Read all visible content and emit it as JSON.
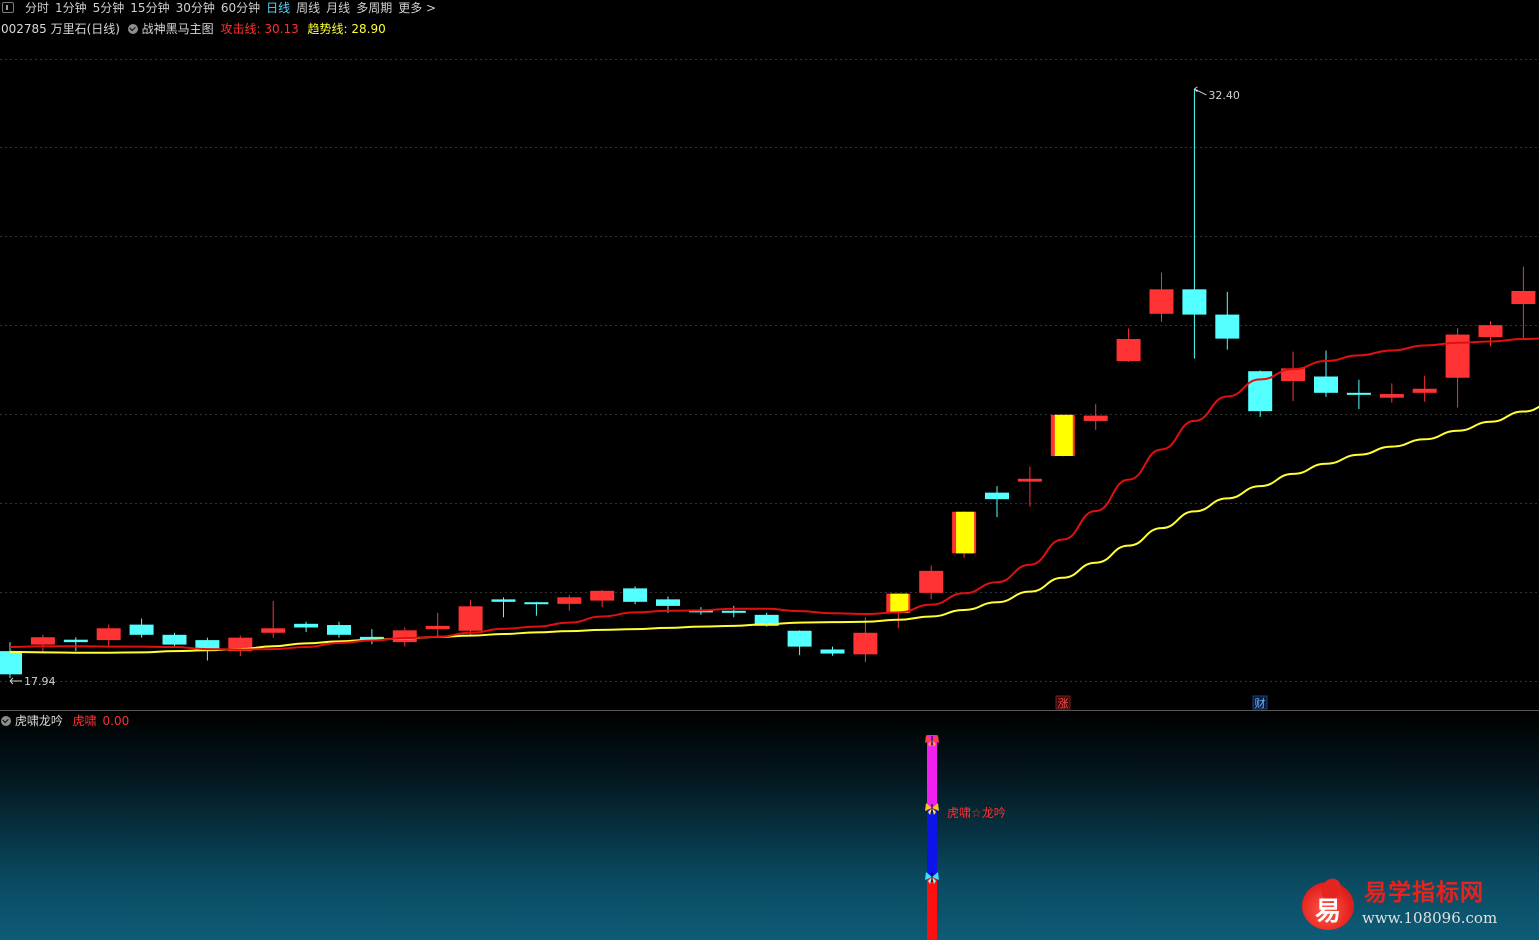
{
  "toolbar": {
    "periods": [
      "分时",
      "1分钟",
      "5分钟",
      "15分钟",
      "30分钟",
      "60分钟",
      "日线",
      "周线",
      "月线",
      "多周期",
      "更多"
    ],
    "active_period": "日线",
    "more_arrow": ">"
  },
  "header": {
    "stock": "002785 万里石(日线)",
    "indicator_name": "战神黑马主图",
    "attack_label": "攻击线: 30.13",
    "trend_label": "趋势线: 28.90"
  },
  "colors": {
    "up": "#ff3333",
    "down": "#54ffff",
    "attack_line": "#e01010",
    "trend_line": "#ffff33",
    "strong_up_fill": "#ffff00",
    "grid": "#333333"
  },
  "markers": {
    "zhang": "涨",
    "cai": "财"
  },
  "indicator_panel": {
    "name": "虎啸龙吟",
    "value_label": "虎啸",
    "value": "0.00",
    "signal_text": "虎啸☆龙吟"
  },
  "watermark": {
    "logo_char": "易",
    "title": "易学指标网",
    "url": "www.108096.com"
  },
  "chart_data": {
    "type": "candlestick",
    "ylim": [
      17.4,
      33.6
    ],
    "max_label": "32.40",
    "min_label": "17.94",
    "candles": [
      {
        "o": 18.6,
        "c": 18.03,
        "h": 18.82,
        "l": 17.94,
        "strong": false
      },
      {
        "o": 18.76,
        "c": 18.94,
        "h": 19.0,
        "l": 18.59,
        "strong": false
      },
      {
        "o": 18.88,
        "c": 18.82,
        "h": 18.94,
        "l": 18.6,
        "strong": false
      },
      {
        "o": 18.87,
        "c": 19.16,
        "h": 19.25,
        "l": 18.71,
        "strong": false
      },
      {
        "o": 19.25,
        "c": 19.0,
        "h": 19.4,
        "l": 18.93,
        "strong": false
      },
      {
        "o": 19.0,
        "c": 18.76,
        "h": 19.05,
        "l": 18.71,
        "strong": false
      },
      {
        "o": 18.87,
        "c": 18.65,
        "h": 18.93,
        "l": 18.37,
        "strong": false
      },
      {
        "o": 18.6,
        "c": 18.93,
        "h": 18.98,
        "l": 18.48,
        "strong": false
      },
      {
        "o": 19.05,
        "c": 19.16,
        "h": 19.83,
        "l": 18.93,
        "strong": false
      },
      {
        "o": 19.27,
        "c": 19.18,
        "h": 19.32,
        "l": 19.07,
        "strong": false
      },
      {
        "o": 19.24,
        "c": 19.0,
        "h": 19.32,
        "l": 18.93,
        "strong": false
      },
      {
        "o": 18.95,
        "c": 18.89,
        "h": 19.14,
        "l": 18.77,
        "strong": false
      },
      {
        "o": 18.82,
        "c": 19.11,
        "h": 19.18,
        "l": 18.71,
        "strong": false
      },
      {
        "o": 19.14,
        "c": 19.22,
        "h": 19.54,
        "l": 18.93,
        "strong": false
      },
      {
        "o": 19.1,
        "c": 19.7,
        "h": 19.86,
        "l": 19.0,
        "strong": false
      },
      {
        "o": 19.87,
        "c": 19.81,
        "h": 19.92,
        "l": 19.43,
        "strong": false
      },
      {
        "o": 19.8,
        "c": 19.79,
        "h": 19.81,
        "l": 19.47,
        "strong": false
      },
      {
        "o": 19.76,
        "c": 19.92,
        "h": 19.97,
        "l": 19.59,
        "strong": false
      },
      {
        "o": 19.84,
        "c": 20.08,
        "h": 20.1,
        "l": 19.68,
        "strong": false
      },
      {
        "o": 20.14,
        "c": 19.81,
        "h": 20.19,
        "l": 19.75,
        "strong": false
      },
      {
        "o": 19.87,
        "c": 19.71,
        "h": 19.94,
        "l": 19.54,
        "strong": false
      },
      {
        "o": 19.6,
        "c": 19.56,
        "h": 19.68,
        "l": 19.49,
        "strong": false
      },
      {
        "o": 19.59,
        "c": 19.54,
        "h": 19.71,
        "l": 19.43,
        "strong": false
      },
      {
        "o": 19.49,
        "c": 19.22,
        "h": 19.54,
        "l": 19.2,
        "strong": false
      },
      {
        "o": 19.1,
        "c": 18.71,
        "h": 19.11,
        "l": 18.5,
        "strong": false
      },
      {
        "o": 18.64,
        "c": 18.54,
        "h": 18.71,
        "l": 18.49,
        "strong": false
      },
      {
        "o": 18.52,
        "c": 19.05,
        "h": 19.43,
        "l": 18.33,
        "strong": false
      },
      {
        "o": 19.54,
        "c": 20.01,
        "h": 20.02,
        "l": 19.16,
        "strong": true
      },
      {
        "o": 20.03,
        "c": 20.57,
        "h": 20.7,
        "l": 19.87,
        "strong": false
      },
      {
        "o": 21.0,
        "c": 22.02,
        "h": 22.03,
        "l": 20.89,
        "strong": true
      },
      {
        "o": 22.49,
        "c": 22.33,
        "h": 22.65,
        "l": 21.89,
        "strong": false
      },
      {
        "o": 22.76,
        "c": 22.83,
        "h": 23.13,
        "l": 22.15,
        "strong": false
      },
      {
        "o": 23.39,
        "c": 24.4,
        "h": 24.4,
        "l": 23.38,
        "strong": true
      },
      {
        "o": 24.25,
        "c": 24.38,
        "h": 24.67,
        "l": 24.03,
        "strong": false
      },
      {
        "o": 25.72,
        "c": 26.26,
        "h": 26.52,
        "l": 25.7,
        "strong": false
      },
      {
        "o": 26.88,
        "c": 27.48,
        "h": 27.89,
        "l": 26.68,
        "strong": false
      },
      {
        "o": 27.48,
        "c": 26.86,
        "h": 32.4,
        "l": 25.78,
        "strong": false
      },
      {
        "o": 26.86,
        "c": 26.27,
        "h": 27.42,
        "l": 26.0,
        "strong": false
      },
      {
        "o": 25.47,
        "c": 24.49,
        "h": 25.49,
        "l": 24.35,
        "strong": false
      },
      {
        "o": 25.23,
        "c": 25.54,
        "h": 25.95,
        "l": 24.74,
        "strong": false
      },
      {
        "o": 25.34,
        "c": 24.94,
        "h": 25.98,
        "l": 24.84,
        "strong": false
      },
      {
        "o": 24.94,
        "c": 24.89,
        "h": 25.26,
        "l": 24.54,
        "strong": false
      },
      {
        "o": 24.82,
        "c": 24.91,
        "h": 25.17,
        "l": 24.7,
        "strong": false
      },
      {
        "o": 24.94,
        "c": 25.04,
        "h": 25.36,
        "l": 24.72,
        "strong": false
      },
      {
        "o": 25.31,
        "c": 26.37,
        "h": 26.53,
        "l": 24.58,
        "strong": false
      },
      {
        "o": 26.31,
        "c": 26.6,
        "h": 26.7,
        "l": 26.08,
        "strong": false
      },
      {
        "o": 27.12,
        "c": 27.44,
        "h": 28.04,
        "l": 26.28,
        "strong": false
      }
    ],
    "attack_line": [
      18.7,
      18.72,
      18.72,
      18.71,
      18.71,
      18.7,
      18.65,
      18.64,
      18.65,
      18.7,
      18.8,
      18.86,
      18.92,
      18.95,
      19.05,
      19.15,
      19.2,
      19.3,
      19.45,
      19.55,
      19.59,
      19.6,
      19.64,
      19.64,
      19.58,
      19.53,
      19.51,
      19.55,
      19.74,
      20.02,
      20.29,
      20.72,
      21.34,
      22.04,
      22.81,
      23.55,
      24.25,
      24.85,
      25.27,
      25.52,
      25.72,
      25.86,
      25.98,
      26.1,
      26.17,
      26.2,
      26.26,
      26.28,
      26.25
    ],
    "trend_line": [
      18.58,
      18.57,
      18.56,
      18.56,
      18.57,
      18.6,
      18.62,
      18.65,
      18.72,
      18.79,
      18.84,
      18.88,
      18.91,
      18.95,
      18.98,
      19.02,
      19.06,
      19.09,
      19.12,
      19.14,
      19.17,
      19.2,
      19.22,
      19.26,
      19.3,
      19.31,
      19.32,
      19.37,
      19.45,
      19.61,
      19.8,
      20.06,
      20.4,
      20.77,
      21.19,
      21.62,
      22.03,
      22.35,
      22.65,
      22.95,
      23.2,
      23.42,
      23.62,
      23.8,
      24.01,
      24.23,
      24.48,
      24.74,
      25.06
    ]
  }
}
